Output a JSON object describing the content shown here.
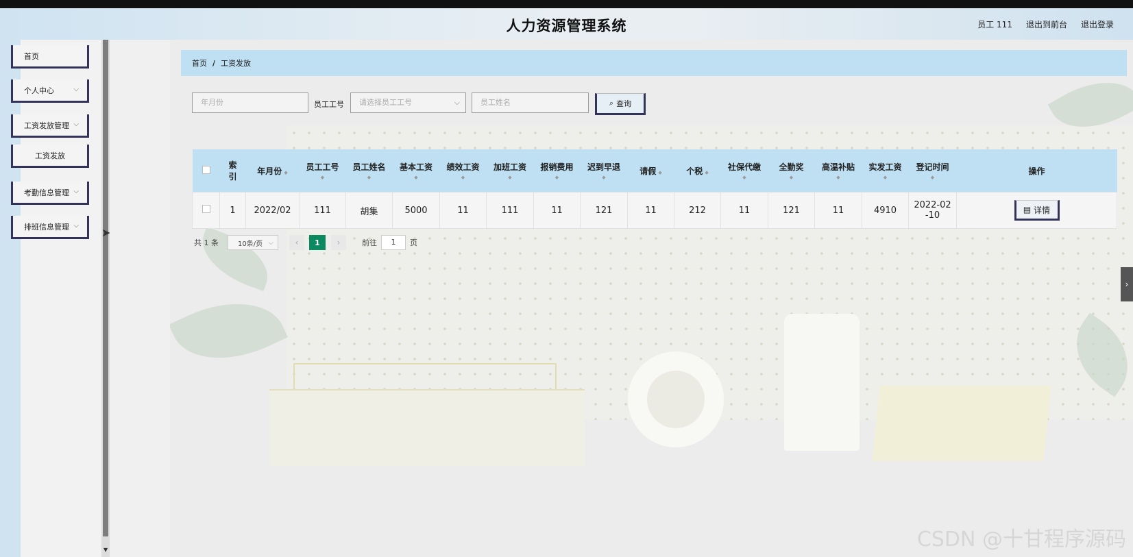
{
  "app": {
    "title": "人力资源管理系统"
  },
  "header_links": {
    "user": "员工 111",
    "to_front": "退出到前台",
    "logout": "退出登录"
  },
  "sidebar": {
    "home": "首页",
    "personal_center": "个人中心",
    "salary_management": "工资发放管理",
    "salary_sub": "工资发放",
    "attendance_management": "考勤信息管理",
    "schedule_management": "排班信息管理"
  },
  "breadcrumb": {
    "home": "首页",
    "sep": "/",
    "current": "工资发放"
  },
  "search": {
    "year_month_placeholder": "年月份",
    "employee_no_label": "员工工号",
    "employee_no_placeholder": "请选择员工工号",
    "employee_name_placeholder": "员工姓名",
    "query_button": "查询"
  },
  "table": {
    "headers": [
      "索引",
      "年月份",
      "员工工号",
      "员工姓名",
      "基本工资",
      "绩效工资",
      "加班工资",
      "报销费用",
      "迟到早退",
      "请假",
      "个税",
      "社保代缴",
      "全勤奖",
      "高温补贴",
      "实发工资",
      "登记时间",
      "操作"
    ],
    "header_index_top": "索",
    "header_index_bottom": "引",
    "rows": [
      {
        "index": "1",
        "year_month": "2022/02",
        "employee_no": "111",
        "employee_name": "胡集",
        "base_salary": "5000",
        "performance": "11",
        "overtime": "111",
        "reimbursement": "11",
        "late_early": "121",
        "leave": "11",
        "tax": "212",
        "social_security": "11",
        "full_attendance": "121",
        "high_temp": "11",
        "actual_pay": "4910",
        "reg_time_line1": "2022-02",
        "reg_time_line2": "-10",
        "action": "详情"
      }
    ]
  },
  "pagination": {
    "total": "共 1 条",
    "page_size": "10条/页",
    "current_page": "1",
    "goto_prefix": "前往",
    "goto_value": "1",
    "goto_suffix": "页"
  },
  "watermark": "CSDN @十甘程序源码"
}
